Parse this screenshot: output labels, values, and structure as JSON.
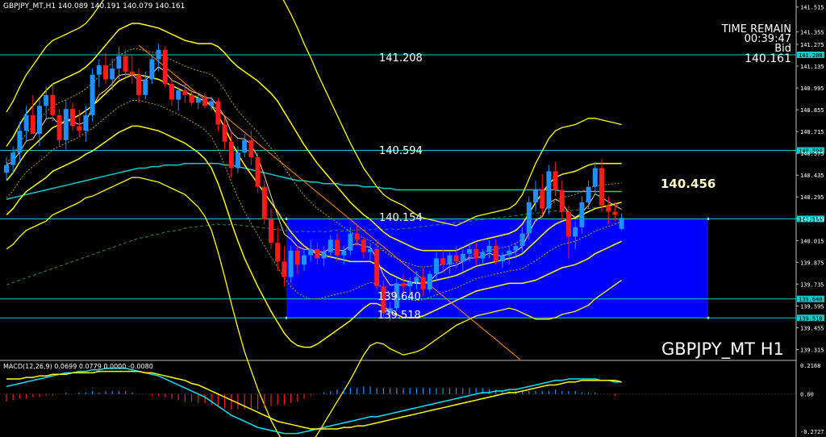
{
  "header": {
    "symbol_info": "GBPJPY_MT,H1  140.089 140.191 140.079 140.161",
    "macd_info": "MACD(12,26,9) 0.0699 0.0779 0.0000 -0.0080"
  },
  "time_remain": {
    "label": "TIME REMAIN",
    "value": "00:39:47",
    "bid_label": "Bid",
    "bid_value": "140.161"
  },
  "symbol_label": "GBPJPY_MT H1",
  "highlight_price": "140.456",
  "levels": [
    {
      "label": "141.208",
      "tag": "141.208"
    },
    {
      "label": "140.594",
      "tag": "140.594"
    },
    {
      "label": "140.154",
      "tag": "140.154"
    },
    {
      "label": "139.640",
      "tag": "139.640"
    },
    {
      "label": "139.518",
      "tag": "139.518"
    }
  ],
  "price_axis": [
    "141.515",
    "141.355",
    "141.275",
    "141.135",
    "140.995",
    "140.855",
    "140.715",
    "140.575",
    "140.435",
    "140.295",
    "140.155",
    "140.015",
    "139.875",
    "139.735",
    "139.595",
    "139.455",
    "139.315"
  ],
  "macd_axis": [
    "0.2168",
    "0.00",
    "-0.2727"
  ],
  "colors": {
    "background": "#000000",
    "bull_candle": "#1e90ff",
    "bear_candle": "#ff1a1a",
    "bollinger": "#ffff00",
    "level_line": "#00cccc",
    "zone": "#0000ff",
    "trendline": "#ff8c00",
    "macd_main": "#00e5ff",
    "macd_signal": "#ffff00"
  },
  "chart_data": {
    "type": "candlestick",
    "ylim": [
      139.25,
      141.56
    ],
    "candles": [
      [
        140.45,
        140.55,
        140.4,
        140.5
      ],
      [
        140.5,
        140.62,
        140.45,
        140.58
      ],
      [
        140.58,
        140.78,
        140.52,
        140.72
      ],
      [
        140.72,
        140.88,
        140.66,
        140.82
      ],
      [
        140.82,
        140.95,
        140.75,
        140.7
      ],
      [
        140.7,
        140.92,
        140.62,
        140.88
      ],
      [
        140.88,
        141.0,
        140.8,
        140.95
      ],
      [
        140.95,
        141.02,
        140.78,
        140.82
      ],
      [
        140.82,
        140.86,
        140.62,
        140.66
      ],
      [
        140.66,
        140.92,
        140.6,
        140.86
      ],
      [
        140.86,
        140.9,
        140.72,
        140.75
      ],
      [
        140.75,
        140.85,
        140.68,
        140.72
      ],
      [
        140.72,
        140.88,
        140.65,
        140.82
      ],
      [
        140.82,
        141.12,
        140.78,
        141.08
      ],
      [
        141.08,
        141.18,
        141.0,
        141.14
      ],
      [
        141.14,
        141.22,
        141.02,
        141.05
      ],
      [
        141.05,
        141.18,
        140.98,
        141.12
      ],
      [
        141.12,
        141.26,
        141.05,
        141.2
      ],
      [
        141.2,
        141.24,
        141.06,
        141.1
      ],
      [
        141.1,
        141.2,
        141.02,
        141.08
      ],
      [
        141.08,
        141.12,
        140.9,
        140.95
      ],
      [
        140.95,
        141.1,
        140.92,
        141.05
      ],
      [
        141.05,
        141.2,
        141.02,
        141.18
      ],
      [
        141.18,
        141.28,
        141.1,
        141.24
      ],
      [
        141.24,
        141.26,
        141.0,
        141.02
      ],
      [
        141.02,
        141.06,
        140.88,
        140.92
      ],
      [
        140.92,
        141.0,
        140.85,
        140.98
      ],
      [
        140.98,
        141.02,
        140.9,
        140.95
      ],
      [
        140.95,
        140.98,
        140.88,
        140.9
      ],
      [
        140.9,
        140.95,
        140.86,
        140.93
      ],
      [
        140.93,
        140.96,
        140.86,
        140.88
      ],
      [
        140.88,
        140.94,
        140.85,
        140.91
      ],
      [
        140.91,
        140.93,
        140.72,
        140.76
      ],
      [
        140.76,
        140.8,
        140.6,
        140.65
      ],
      [
        140.65,
        140.72,
        140.42,
        140.48
      ],
      [
        140.48,
        140.62,
        140.45,
        140.58
      ],
      [
        140.58,
        140.7,
        140.55,
        140.66
      ],
      [
        140.66,
        140.72,
        140.5,
        140.55
      ],
      [
        140.55,
        140.58,
        140.32,
        140.36
      ],
      [
        140.36,
        140.4,
        140.12,
        140.15
      ],
      [
        140.15,
        140.22,
        139.96,
        140.0
      ],
      [
        140.0,
        140.1,
        139.82,
        139.88
      ],
      [
        139.88,
        139.98,
        139.72,
        139.78
      ],
      [
        139.78,
        139.98,
        139.74,
        139.95
      ],
      [
        139.95,
        139.98,
        139.8,
        139.86
      ],
      [
        139.86,
        139.96,
        139.82,
        139.92
      ],
      [
        139.92,
        140.02,
        139.88,
        139.96
      ],
      [
        139.96,
        140.0,
        139.86,
        139.9
      ],
      [
        139.9,
        139.98,
        139.85,
        139.94
      ],
      [
        139.94,
        140.05,
        139.9,
        140.02
      ],
      [
        140.02,
        140.06,
        139.88,
        139.92
      ],
      [
        139.92,
        139.98,
        139.86,
        139.95
      ],
      [
        139.95,
        140.1,
        139.92,
        140.06
      ],
      [
        140.06,
        140.12,
        139.98,
        140.02
      ],
      [
        140.02,
        140.04,
        139.9,
        139.94
      ],
      [
        139.94,
        140.0,
        139.88,
        139.96
      ],
      [
        139.96,
        140.02,
        139.7,
        139.72
      ],
      [
        139.72,
        139.76,
        139.52,
        139.55
      ],
      [
        139.55,
        139.62,
        139.5,
        139.58
      ],
      [
        139.58,
        139.78,
        139.56,
        139.74
      ],
      [
        139.74,
        139.8,
        139.68,
        139.72
      ],
      [
        139.72,
        139.78,
        139.64,
        139.75
      ],
      [
        139.75,
        139.82,
        139.7,
        139.78
      ],
      [
        139.78,
        139.84,
        139.66,
        139.7
      ],
      [
        139.7,
        139.82,
        139.68,
        139.8
      ],
      [
        139.8,
        139.94,
        139.76,
        139.9
      ],
      [
        139.9,
        139.96,
        139.82,
        139.86
      ],
      [
        139.86,
        139.94,
        139.8,
        139.92
      ],
      [
        139.92,
        139.98,
        139.84,
        139.88
      ],
      [
        139.88,
        139.96,
        139.82,
        139.93
      ],
      [
        139.93,
        140.0,
        139.88,
        139.96
      ],
      [
        139.96,
        140.0,
        139.86,
        139.9
      ],
      [
        139.9,
        139.96,
        139.86,
        139.94
      ],
      [
        139.94,
        140.02,
        139.9,
        139.98
      ],
      [
        139.98,
        140.02,
        139.86,
        139.88
      ],
      [
        139.88,
        139.94,
        139.84,
        139.92
      ],
      [
        139.92,
        139.98,
        139.86,
        139.95
      ],
      [
        139.95,
        140.0,
        139.9,
        139.98
      ],
      [
        139.98,
        140.1,
        139.94,
        140.06
      ],
      [
        140.06,
        140.3,
        140.02,
        140.26
      ],
      [
        140.26,
        140.4,
        140.2,
        140.34
      ],
      [
        140.34,
        140.44,
        140.18,
        140.22
      ],
      [
        140.22,
        140.5,
        140.18,
        140.46
      ],
      [
        140.46,
        140.52,
        140.3,
        140.34
      ],
      [
        140.34,
        140.4,
        140.15,
        140.2
      ],
      [
        140.2,
        140.24,
        139.9,
        140.04
      ],
      [
        140.04,
        140.14,
        139.96,
        140.1
      ],
      [
        140.1,
        140.3,
        140.06,
        140.26
      ],
      [
        140.26,
        140.4,
        140.22,
        140.36
      ],
      [
        140.36,
        140.52,
        140.32,
        140.48
      ],
      [
        140.48,
        140.54,
        140.2,
        140.24
      ],
      [
        140.24,
        140.3,
        140.12,
        140.2
      ],
      [
        140.2,
        140.26,
        140.14,
        140.18
      ],
      [
        140.09,
        140.19,
        140.08,
        140.16
      ]
    ],
    "levels": [
      141.208,
      140.594,
      140.154,
      139.64,
      139.518
    ],
    "zone": {
      "top": 140.154,
      "bottom": 139.518
    },
    "trendline": [
      [
        141.27,
        0
      ],
      [
        139.27,
        1
      ]
    ],
    "bb_mid": [
      140.4,
      140.45,
      140.52,
      140.58,
      140.62,
      140.66,
      140.7,
      140.74,
      140.76,
      140.78,
      140.8,
      140.82,
      140.85,
      140.88,
      140.92,
      140.96,
      141.0,
      141.04,
      141.06,
      141.08,
      141.08,
      141.07,
      141.06,
      141.05,
      141.03,
      141.01,
      140.99,
      140.97,
      140.95,
      140.93,
      140.91,
      140.88,
      140.82,
      140.74,
      140.65,
      140.57,
      140.5,
      140.44,
      140.38,
      140.32,
      140.26,
      140.2,
      140.13,
      140.07,
      140.02,
      139.98,
      139.95,
      139.93,
      139.92,
      139.91,
      139.9,
      139.89,
      139.88,
      139.88,
      139.88,
      139.88,
      139.86,
      139.83,
      139.8,
      139.78,
      139.76,
      139.75,
      139.74,
      139.74,
      139.75,
      139.76,
      139.77,
      139.78,
      139.79,
      139.81,
      139.83,
      139.85,
      139.86,
      139.87,
      139.88,
      139.89,
      139.9,
      139.91,
      139.93,
      139.97,
      140.01,
      140.05,
      140.09,
      140.12,
      140.14,
      140.15,
      140.16,
      140.18,
      140.2,
      140.22,
      140.23,
      140.24,
      140.25,
      140.26
    ],
    "bb_dev": [
      0.22,
      0.23,
      0.24,
      0.25,
      0.26,
      0.27,
      0.28,
      0.28,
      0.28,
      0.28,
      0.28,
      0.28,
      0.28,
      0.29,
      0.3,
      0.31,
      0.32,
      0.33,
      0.33,
      0.33,
      0.33,
      0.33,
      0.33,
      0.33,
      0.33,
      0.33,
      0.33,
      0.33,
      0.34,
      0.35,
      0.37,
      0.4,
      0.44,
      0.48,
      0.52,
      0.56,
      0.6,
      0.63,
      0.66,
      0.68,
      0.7,
      0.71,
      0.71,
      0.7,
      0.68,
      0.65,
      0.62,
      0.58,
      0.54,
      0.5,
      0.46,
      0.42,
      0.38,
      0.34,
      0.3,
      0.27,
      0.25,
      0.24,
      0.24,
      0.24,
      0.24,
      0.23,
      0.22,
      0.21,
      0.2,
      0.19,
      0.18,
      0.17,
      0.16,
      0.16,
      0.16,
      0.16,
      0.16,
      0.16,
      0.16,
      0.16,
      0.16,
      0.17,
      0.19,
      0.22,
      0.25,
      0.27,
      0.29,
      0.3,
      0.3,
      0.3,
      0.3,
      0.3,
      0.3,
      0.29,
      0.28,
      0.27,
      0.26,
      0.25
    ],
    "ma_long": [
      140.28,
      140.29,
      140.3,
      140.31,
      140.32,
      140.33,
      140.34,
      140.35,
      140.36,
      140.37,
      140.38,
      140.39,
      140.4,
      140.41,
      140.42,
      140.43,
      140.44,
      140.45,
      140.46,
      140.47,
      140.48,
      140.48,
      140.49,
      140.49,
      140.5,
      140.5,
      140.5,
      140.51,
      140.51,
      140.51,
      140.51,
      140.51,
      140.51,
      140.5,
      140.5,
      140.49,
      140.48,
      140.47,
      140.46,
      140.45,
      140.44,
      140.43,
      140.42,
      140.41,
      140.4,
      140.4,
      140.39,
      140.39,
      140.38,
      140.38,
      140.38,
      140.37,
      140.37,
      140.37,
      140.36,
      140.36,
      140.36,
      140.35,
      140.35,
      140.34,
      140.34,
      140.34,
      140.34,
      140.34,
      140.34,
      140.34,
      140.34,
      140.34,
      140.34,
      140.34,
      140.34,
      140.34,
      140.34,
      140.34,
      140.34,
      140.34,
      140.34,
      140.34,
      140.34,
      140.34,
      140.34,
      140.34,
      140.34,
      140.34,
      140.33,
      140.33,
      140.33,
      140.33,
      140.33,
      140.33,
      140.33,
      140.33,
      140.33,
      140.33
    ],
    "macd_main": [
      0.05,
      0.06,
      0.07,
      0.08,
      0.09,
      0.1,
      0.11,
      0.12,
      0.13,
      0.14,
      0.14,
      0.15,
      0.15,
      0.16,
      0.16,
      0.17,
      0.17,
      0.17,
      0.17,
      0.16,
      0.15,
      0.14,
      0.13,
      0.12,
      0.1,
      0.08,
      0.06,
      0.04,
      0.02,
      0.0,
      -0.02,
      -0.05,
      -0.08,
      -0.11,
      -0.14,
      -0.16,
      -0.18,
      -0.2,
      -0.22,
      -0.23,
      -0.24,
      -0.25,
      -0.26,
      -0.26,
      -0.26,
      -0.25,
      -0.24,
      -0.23,
      -0.22,
      -0.21,
      -0.2,
      -0.19,
      -0.18,
      -0.17,
      -0.16,
      -0.15,
      -0.15,
      -0.14,
      -0.13,
      -0.12,
      -0.11,
      -0.1,
      -0.09,
      -0.08,
      -0.07,
      -0.06,
      -0.05,
      -0.04,
      -0.03,
      -0.02,
      -0.01,
      0.0,
      0.01,
      0.01,
      0.02,
      0.02,
      0.03,
      0.03,
      0.04,
      0.05,
      0.06,
      0.07,
      0.08,
      0.09,
      0.09,
      0.1,
      0.1,
      0.1,
      0.1,
      0.1,
      0.09,
      0.09,
      0.08,
      0.08
    ],
    "macd_signal": [
      0.1,
      0.1,
      0.1,
      0.11,
      0.11,
      0.12,
      0.12,
      0.13,
      0.13,
      0.13,
      0.14,
      0.14,
      0.14,
      0.14,
      0.15,
      0.15,
      0.15,
      0.15,
      0.15,
      0.15,
      0.15,
      0.14,
      0.14,
      0.13,
      0.12,
      0.11,
      0.1,
      0.09,
      0.07,
      0.06,
      0.04,
      0.02,
      0.0,
      -0.02,
      -0.04,
      -0.06,
      -0.08,
      -0.1,
      -0.12,
      -0.14,
      -0.16,
      -0.18,
      -0.19,
      -0.2,
      -0.21,
      -0.22,
      -0.23,
      -0.23,
      -0.23,
      -0.23,
      -0.23,
      -0.22,
      -0.22,
      -0.21,
      -0.21,
      -0.2,
      -0.19,
      -0.18,
      -0.17,
      -0.16,
      -0.15,
      -0.14,
      -0.13,
      -0.12,
      -0.11,
      -0.1,
      -0.09,
      -0.08,
      -0.07,
      -0.06,
      -0.05,
      -0.04,
      -0.03,
      -0.02,
      -0.01,
      0.0,
      0.01,
      0.01,
      0.02,
      0.03,
      0.04,
      0.05,
      0.06,
      0.06,
      0.07,
      0.08,
      0.08,
      0.09,
      0.09,
      0.09,
      0.09,
      0.09,
      0.09,
      0.08
    ]
  }
}
